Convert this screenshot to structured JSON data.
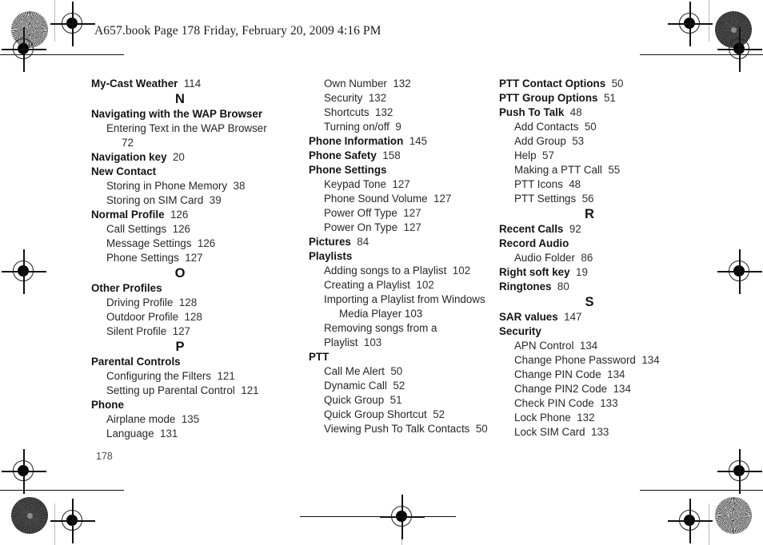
{
  "document": {
    "file_stamp": "A657.book  Page 178  Friday, February 20, 2009  4:16 PM",
    "page_number": "178"
  },
  "index": {
    "columns": [
      {
        "id": "column-1",
        "blocks": [
          {
            "type": "entry",
            "label": "My-Cast Weather",
            "page": "114"
          },
          {
            "type": "letter",
            "label": "N"
          },
          {
            "type": "entry",
            "label": "Navigating with the WAP Browser",
            "page": ""
          },
          {
            "type": "sub",
            "label": "Entering Text in the WAP Browser",
            "cont": "72",
            "page": ""
          },
          {
            "type": "entry",
            "label": "Navigation key",
            "page": "20"
          },
          {
            "type": "entry",
            "label": "New Contact",
            "page": ""
          },
          {
            "type": "sub",
            "label": "Storing in Phone Memory",
            "page": "38"
          },
          {
            "type": "sub",
            "label": "Storing on SIM Card",
            "page": "39"
          },
          {
            "type": "entry",
            "label": "Normal Profile",
            "page": "126"
          },
          {
            "type": "sub",
            "label": "Call Settings",
            "page": "126"
          },
          {
            "type": "sub",
            "label": "Message Settings",
            "page": "126"
          },
          {
            "type": "sub",
            "label": "Phone Settings",
            "page": "127"
          },
          {
            "type": "letter",
            "label": "O"
          },
          {
            "type": "entry",
            "label": "Other Profiles",
            "page": ""
          },
          {
            "type": "sub",
            "label": "Driving Profile",
            "page": "128"
          },
          {
            "type": "sub",
            "label": "Outdoor Profile",
            "page": "128"
          },
          {
            "type": "sub",
            "label": "Silent Profile",
            "page": "127"
          },
          {
            "type": "letter",
            "label": "P"
          },
          {
            "type": "entry",
            "label": "Parental Controls",
            "page": ""
          },
          {
            "type": "sub",
            "label": "Configuring the Filters",
            "page": "121"
          },
          {
            "type": "sub",
            "label": "Setting up Parental Control",
            "page": "121"
          },
          {
            "type": "entry",
            "label": "Phone",
            "page": ""
          },
          {
            "type": "sub",
            "label": "Airplane mode",
            "page": "135"
          },
          {
            "type": "sub",
            "label": "Language",
            "page": "131"
          }
        ]
      },
      {
        "id": "column-2",
        "blocks": [
          {
            "type": "sub",
            "label": "Own Number",
            "page": "132"
          },
          {
            "type": "sub",
            "label": "Security",
            "page": "132"
          },
          {
            "type": "sub",
            "label": "Shortcuts",
            "page": "132"
          },
          {
            "type": "sub",
            "label": "Turning on/off",
            "page": "9"
          },
          {
            "type": "entry",
            "label": "Phone Information",
            "page": "145"
          },
          {
            "type": "entry",
            "label": "Phone Safety",
            "page": "158"
          },
          {
            "type": "entry",
            "label": "Phone Settings",
            "page": ""
          },
          {
            "type": "sub",
            "label": "Keypad Tone",
            "page": "127"
          },
          {
            "type": "sub",
            "label": "Phone Sound Volume",
            "page": "127"
          },
          {
            "type": "sub",
            "label": "Power Off Type",
            "page": "127"
          },
          {
            "type": "sub",
            "label": "Power On Type",
            "page": "127"
          },
          {
            "type": "entry",
            "label": "Pictures",
            "page": "84"
          },
          {
            "type": "entry",
            "label": "Playlists",
            "page": ""
          },
          {
            "type": "sub",
            "label": "Adding songs to a Playlist",
            "page": "102"
          },
          {
            "type": "sub",
            "label": "Creating a Playlist",
            "page": "102"
          },
          {
            "type": "sub",
            "label": "Importing a Playlist from Windows",
            "cont": "Media Player  103",
            "page": ""
          },
          {
            "type": "sub",
            "label": "Removing songs from a Playlist",
            "page": "103"
          },
          {
            "type": "entry",
            "label": "PTT",
            "page": ""
          },
          {
            "type": "sub",
            "label": "Call Me Alert",
            "page": "50"
          },
          {
            "type": "sub",
            "label": "Dynamic Call",
            "page": "52"
          },
          {
            "type": "sub",
            "label": "Quick Group",
            "page": "51"
          },
          {
            "type": "sub",
            "label": "Quick Group Shortcut",
            "page": "52"
          },
          {
            "type": "sub",
            "label": "Viewing Push To Talk Contacts",
            "page": "50"
          }
        ]
      },
      {
        "id": "column-3",
        "blocks": [
          {
            "type": "entry",
            "label": "PTT Contact Options",
            "page": "50"
          },
          {
            "type": "entry",
            "label": "PTT Group Options",
            "page": "51"
          },
          {
            "type": "entry",
            "label": "Push To Talk",
            "page": "48"
          },
          {
            "type": "sub",
            "label": "Add Contacts",
            "page": "50"
          },
          {
            "type": "sub",
            "label": "Add Group",
            "page": "53"
          },
          {
            "type": "sub",
            "label": "Help",
            "page": "57"
          },
          {
            "type": "sub",
            "label": "Making a PTT Call",
            "page": "55"
          },
          {
            "type": "sub",
            "label": "PTT Icons",
            "page": "48"
          },
          {
            "type": "sub",
            "label": "PTT Settings",
            "page": "56"
          },
          {
            "type": "letter",
            "label": "R"
          },
          {
            "type": "entry",
            "label": "Recent Calls",
            "page": "92"
          },
          {
            "type": "entry",
            "label": "Record Audio",
            "page": ""
          },
          {
            "type": "sub",
            "label": "Audio Folder",
            "page": "86"
          },
          {
            "type": "entry",
            "label": "Right soft key",
            "page": "19"
          },
          {
            "type": "entry",
            "label": "Ringtones",
            "page": "80"
          },
          {
            "type": "letter",
            "label": "S"
          },
          {
            "type": "entry",
            "label": "SAR values",
            "page": "147"
          },
          {
            "type": "entry",
            "label": "Security",
            "page": ""
          },
          {
            "type": "sub",
            "label": "APN Control",
            "page": "134"
          },
          {
            "type": "sub",
            "label": "Change Phone Password",
            "page": "134"
          },
          {
            "type": "sub",
            "label": "Change PIN Code",
            "page": "134"
          },
          {
            "type": "sub",
            "label": "Change PIN2 Code",
            "page": "134"
          },
          {
            "type": "sub",
            "label": "Check PIN Code",
            "page": "133"
          },
          {
            "type": "sub",
            "label": "Lock Phone",
            "page": "132"
          },
          {
            "type": "sub",
            "label": "Lock SIM Card",
            "page": "133"
          }
        ]
      }
    ]
  }
}
